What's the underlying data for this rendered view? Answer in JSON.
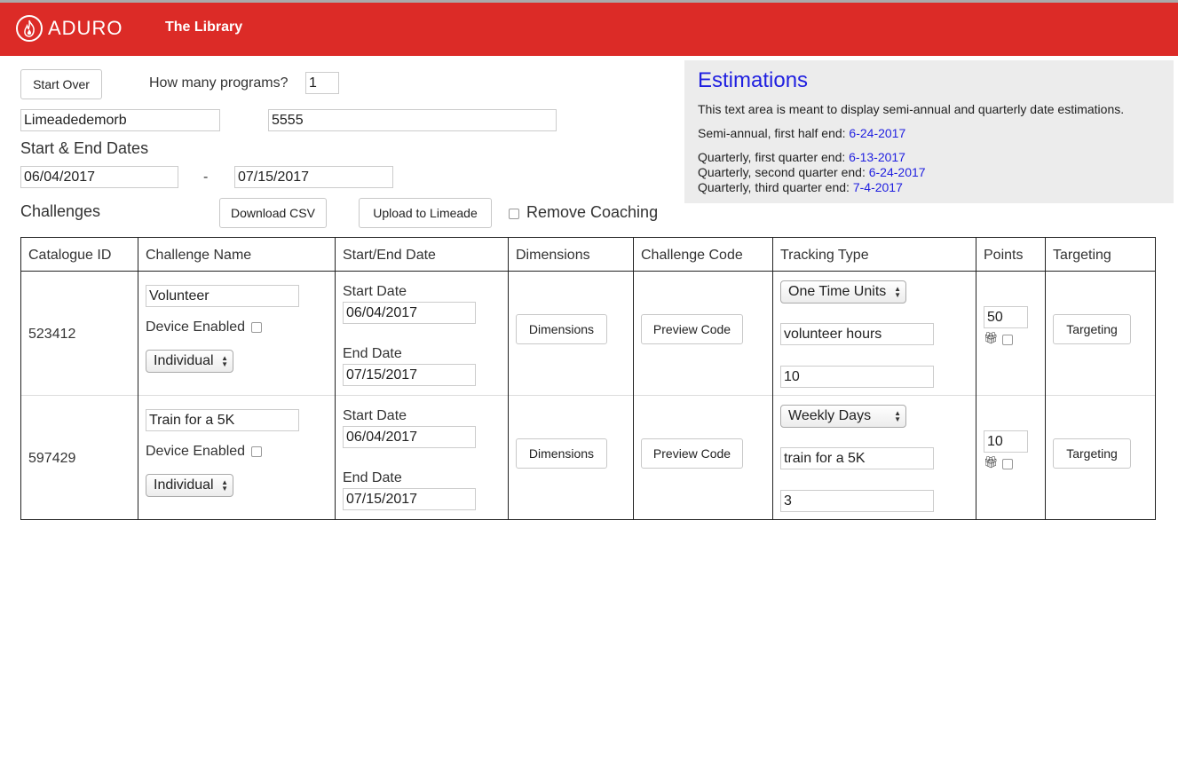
{
  "header": {
    "logo_text": "ADURO",
    "title": "The Library"
  },
  "controls": {
    "start_over": "Start Over",
    "programs_label": "How many programs?",
    "programs_value": "1",
    "org_value": "Limeadedemorb",
    "id_value": "5555",
    "dates_label": "Start & End Dates",
    "start_date": "06/04/2017",
    "date_sep": "-",
    "end_date": "07/15/2017",
    "challenges_label": "Challenges",
    "download_csv": "Download CSV",
    "upload_limeade": "Upload to Limeade",
    "remove_coaching": "Remove Coaching"
  },
  "estimations": {
    "title": "Estimations",
    "description": "This text area is meant to display semi-annual and quarterly date estimations.",
    "semi_label": "Semi-annual, first half end: ",
    "semi_value": "6-24-2017",
    "q1_label": "Quarterly, first quarter end: ",
    "q1_value": "6-13-2017",
    "q2_label": "Quarterly, second quarter end: ",
    "q2_value": "6-24-2017",
    "q3_label": "Quarterly, third quarter end: ",
    "q3_value": "7-4-2017"
  },
  "table": {
    "headers": [
      "Catalogue ID",
      "Challenge Name",
      "Start/End Date",
      "Dimensions",
      "Challenge Code",
      "Tracking Type",
      "Points",
      "Targeting"
    ],
    "rows": [
      {
        "id": "523412",
        "name": "Volunteer",
        "device_label": "Device Enabled",
        "mode": "Individual",
        "start_label": "Start Date",
        "start": "06/04/2017",
        "end_label": "End Date",
        "end": "07/15/2017",
        "dimensions_btn": "Dimensions",
        "preview_btn": "Preview Code",
        "tracking_type": "One Time Units",
        "tracking_text": "volunteer hours",
        "tracking_amount": "10",
        "points": "50",
        "targeting_btn": "Targeting"
      },
      {
        "id": "597429",
        "name": "Train for a 5K",
        "device_label": "Device Enabled",
        "mode": "Individual",
        "start_label": "Start Date",
        "start": "06/04/2017",
        "end_label": "End Date",
        "end": "07/15/2017",
        "dimensions_btn": "Dimensions",
        "preview_btn": "Preview Code",
        "tracking_type": "Weekly Days",
        "tracking_text": "train for a 5K",
        "tracking_amount": "3",
        "points": "10",
        "targeting_btn": "Targeting"
      }
    ]
  },
  "icons": {
    "logo": "flame-icon",
    "gift": "gift-icon"
  },
  "colors": {
    "navbar": "#dc2b27",
    "estimation_accent": "#1f1fe0",
    "estimation_bg": "#ececec"
  }
}
